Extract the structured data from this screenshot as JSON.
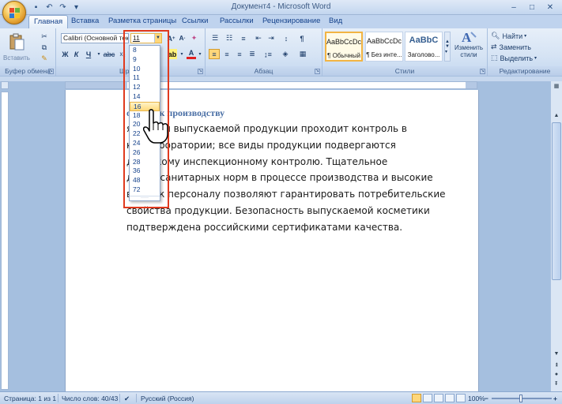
{
  "window": {
    "title": "Документ4 - Microsoft Word"
  },
  "tabs": [
    "Главная",
    "Вставка",
    "Разметка страницы",
    "Ссылки",
    "Рассылки",
    "Рецензирование",
    "Вид"
  ],
  "ribbon": {
    "clipboard": {
      "paste_label": "Вставить",
      "group_label": "Буфер обмена"
    },
    "font": {
      "font_name": "Calibri (Основной текст)",
      "font_size": "11",
      "group_label": "Шрифт"
    },
    "paragraph": {
      "group_label": "Абзац"
    },
    "styles": {
      "items": [
        {
          "sample": "AaBbCcDc",
          "name": "¶ Обычный"
        },
        {
          "sample": "AaBbCcDc",
          "name": "¶ Без инте..."
        },
        {
          "sample": "AaBbC",
          "name": "Заголово..."
        }
      ],
      "change_label": "Изменить стили",
      "group_label": "Стили"
    },
    "editing": {
      "find": "Найти",
      "replace": "Заменить",
      "select": "Выделить",
      "group_label": "Редактирование"
    }
  },
  "font_size_dropdown": {
    "options": [
      "8",
      "9",
      "10",
      "11",
      "12",
      "14",
      "16",
      "18",
      "20",
      "22",
      "24",
      "26",
      "28",
      "36",
      "48",
      "72"
    ],
    "highlighted": "16"
  },
  "document": {
    "heading": "ования к производству",
    "lines": [
      "я партия выпускаемой продукции проходит контроль в",
      "кой лаборатории;  все виды продукции подвергаются",
      "дическому  инспекционному  контролю.  Тщательное",
      "дение санитарных норм в процессе производства и высокие",
      "вания  к персоналу позволяют гарантировать  потребительские",
      "свойства продукции. Безопасность выпускаемой косметики",
      "подтверждена российскими  сертификатами  качества."
    ]
  },
  "statusbar": {
    "page": "Страница: 1 из 1",
    "words": "Число слов: 40/43",
    "language": "Русский (Россия)",
    "zoom": "100%"
  }
}
